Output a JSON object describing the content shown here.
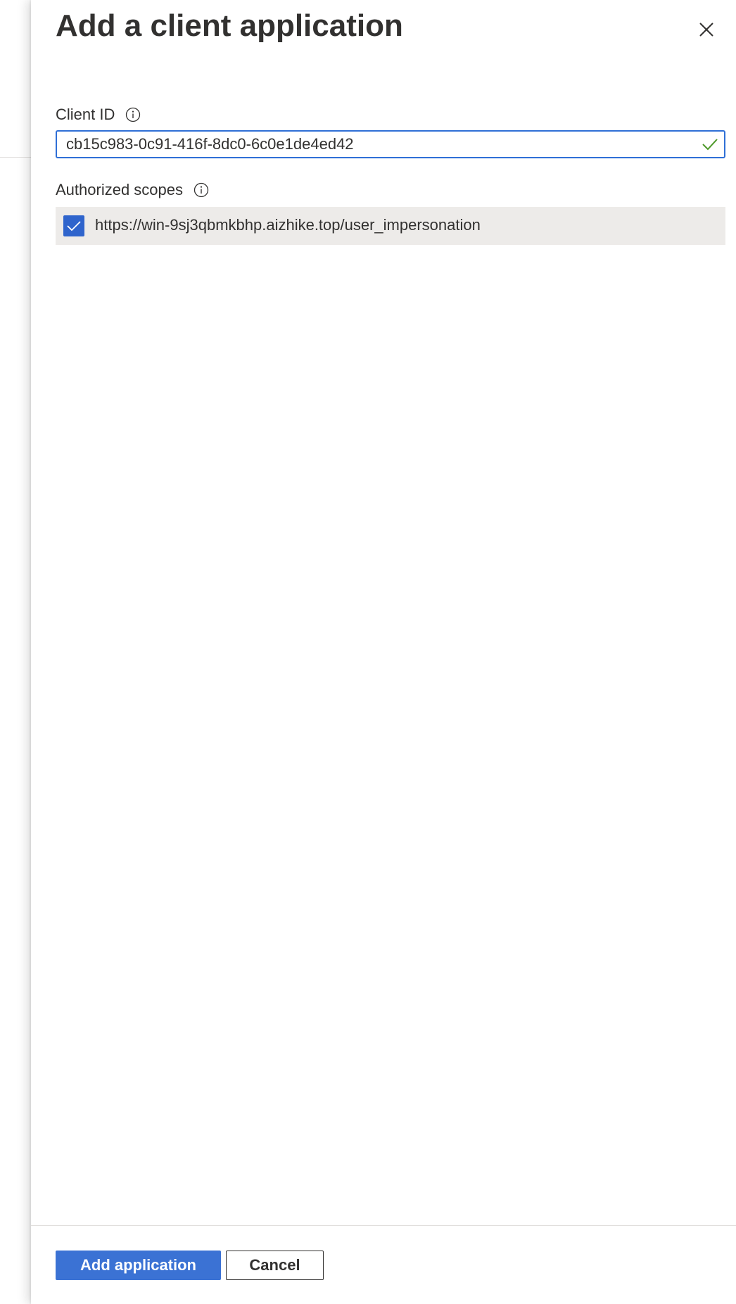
{
  "panel": {
    "title": "Add a client application"
  },
  "client_id": {
    "label": "Client ID",
    "value": "cb15c983-0c91-416f-8dc0-6c0e1de4ed42",
    "valid": true
  },
  "authorized_scopes": {
    "label": "Authorized scopes",
    "items": [
      {
        "scope": "https://win-9sj3qbmkbhp.aizhike.top/user_impersonation",
        "checked": true
      }
    ]
  },
  "footer": {
    "add_label": "Add application",
    "cancel_label": "Cancel"
  },
  "colors": {
    "accent": "#3b72d4",
    "input_focus_border": "#2f6fd6",
    "valid_check": "#4f9a2c",
    "scope_row_bg": "#edebe9"
  },
  "icons": {
    "close": "close-icon",
    "info": "info-icon",
    "valid": "checkmark-icon",
    "checkbox": "checkbox-checked-icon"
  }
}
